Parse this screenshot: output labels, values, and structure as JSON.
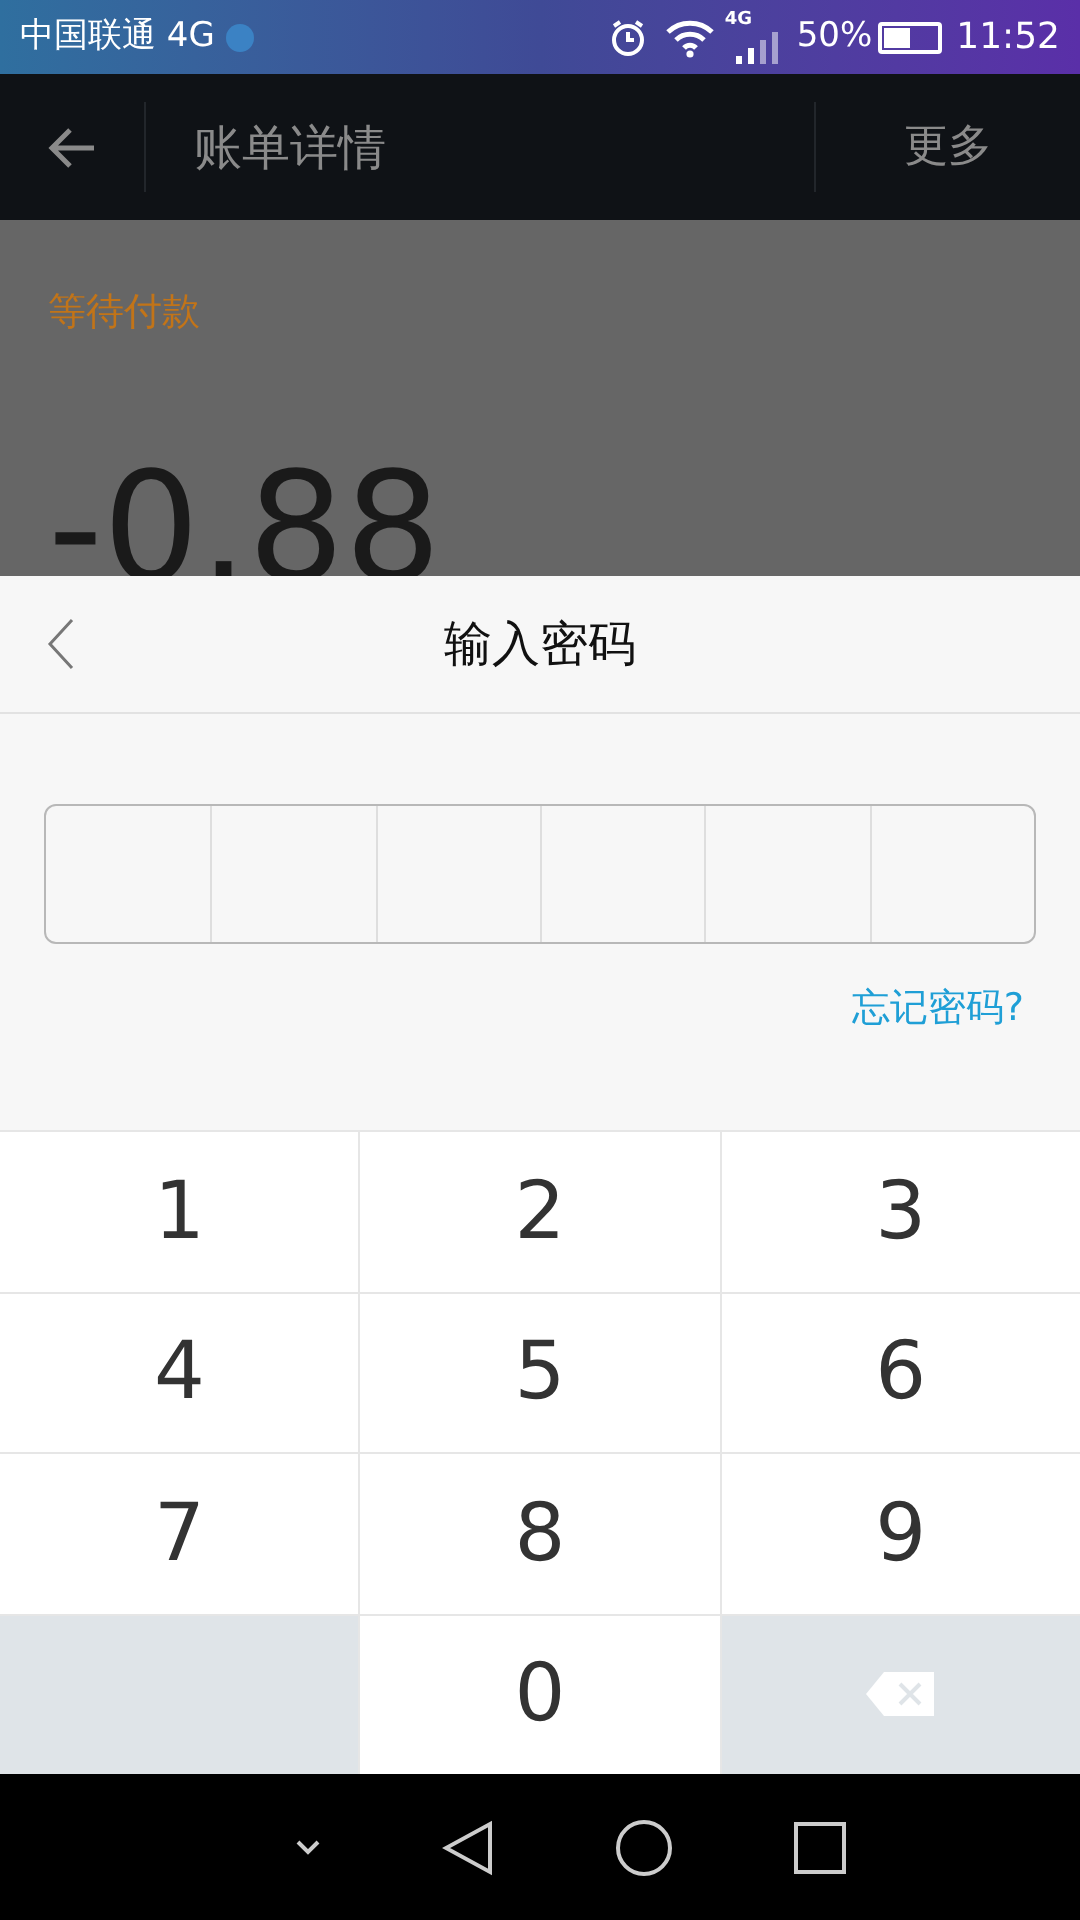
{
  "status_bar": {
    "carrier": "中国联通 4G",
    "network": "4G",
    "battery": "50%",
    "time": "11:52"
  },
  "header": {
    "title": "账单详情",
    "more": "更多"
  },
  "bill": {
    "status": "等待付款",
    "amount": "-0.88"
  },
  "dialog": {
    "title": "输入密码",
    "forgot": "忘记密码?"
  },
  "keypad": [
    {
      "kind": "digit",
      "label": "1"
    },
    {
      "kind": "digit",
      "label": "2"
    },
    {
      "kind": "digit",
      "label": "3"
    },
    {
      "kind": "digit",
      "label": "4"
    },
    {
      "kind": "digit",
      "label": "5"
    },
    {
      "kind": "digit",
      "label": "6"
    },
    {
      "kind": "digit",
      "label": "7"
    },
    {
      "kind": "digit",
      "label": "8"
    },
    {
      "kind": "digit",
      "label": "9"
    },
    {
      "kind": "blank"
    },
    {
      "kind": "digit",
      "label": "0"
    },
    {
      "kind": "backspace"
    }
  ]
}
